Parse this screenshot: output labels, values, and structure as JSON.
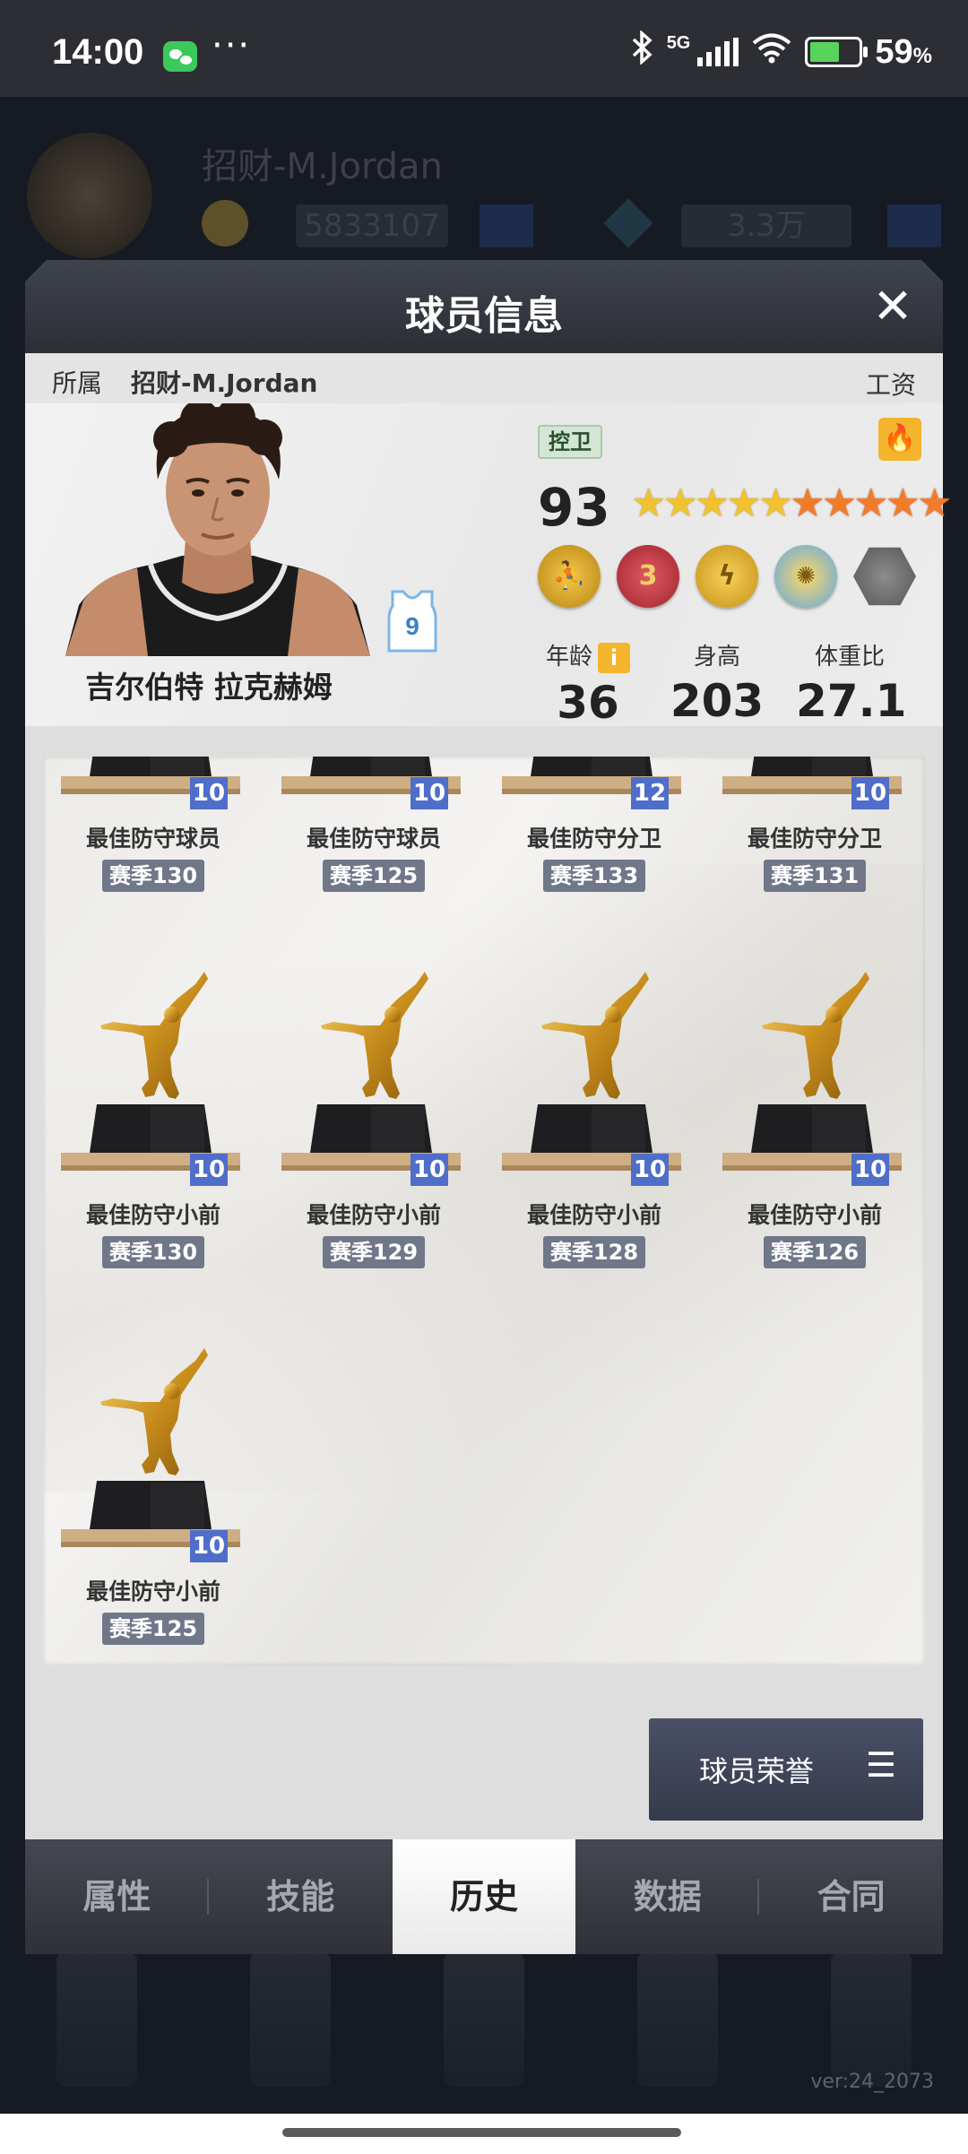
{
  "status_bar": {
    "time": "14:00",
    "dots": "···",
    "network": "5G",
    "battery_percent": "59",
    "percent_sign": "%"
  },
  "background": {
    "team_name": "招财-M.Jordan",
    "coins": "5833107",
    "gems": "3.3万",
    "version": "ver:24_2073"
  },
  "modal": {
    "title": "球员信息",
    "close_icon": "close-icon",
    "team_label": "所属",
    "team_name": "招财-M.Jordan",
    "salary_label": "工资"
  },
  "player": {
    "name": "吉尔伯特 拉克赫姆",
    "jersey_number": "9",
    "position": "控卫",
    "rating": "93",
    "stars": {
      "gold": 5,
      "orange": 5
    },
    "medal_icons": [
      "player-medal-icon",
      "level-3-medal-icon",
      "lightning-medal-icon",
      "web-medal-icon",
      "locked-hexagon-icon"
    ],
    "medal_3_text": "3",
    "age_label": "年龄",
    "age_info": "i",
    "age": "36",
    "height_label": "身高",
    "height": "203",
    "weight_ratio_label": "体重比",
    "weight_ratio": "27.1"
  },
  "honors": {
    "trophies": [
      {
        "count": "10",
        "title": "最佳防守球员",
        "season": "赛季130"
      },
      {
        "count": "10",
        "title": "最佳防守球员",
        "season": "赛季125"
      },
      {
        "count": "12",
        "title": "最佳防守分卫",
        "season": "赛季133"
      },
      {
        "count": "10",
        "title": "最佳防守分卫",
        "season": "赛季131"
      },
      {
        "count": "10",
        "title": "最佳防守小前",
        "season": "赛季130"
      },
      {
        "count": "10",
        "title": "最佳防守小前",
        "season": "赛季129"
      },
      {
        "count": "10",
        "title": "最佳防守小前",
        "season": "赛季128"
      },
      {
        "count": "10",
        "title": "最佳防守小前",
        "season": "赛季126"
      },
      {
        "count": "10",
        "title": "最佳防守小前",
        "season": "赛季125"
      }
    ],
    "button_label": "球员荣誉",
    "button_icon": "menu-icon"
  },
  "tabs": [
    {
      "label": "属性",
      "active": false
    },
    {
      "label": "技能",
      "active": false
    },
    {
      "label": "历史",
      "active": true
    },
    {
      "label": "数据",
      "active": false
    },
    {
      "label": "合同",
      "active": false
    }
  ]
}
